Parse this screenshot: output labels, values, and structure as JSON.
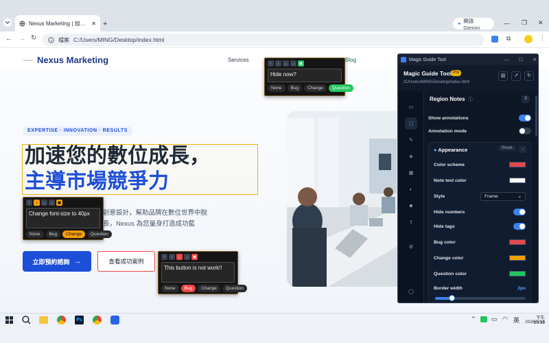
{
  "browser": {
    "tab_title": "Nexus Marketing | 加速您的數",
    "new_tab": "+",
    "gemini": "開啟 Gemini",
    "address_label": "檔案",
    "url": "C:/Users/MING/Desktop/index.html"
  },
  "site": {
    "brand": "Nexus Marketing",
    "nav": [
      "Services",
      "Blog"
    ],
    "badge": "EXPERTISE · INNOVATION · RESULTS",
    "headline_line1": "加速您的數位成長，",
    "headline_line2": "主導市場競爭力",
    "desc_line1": "創意設計，幫助品牌在數位世界中脫",
    "desc_line2": "長，Nexus 為您量身打造成功藍",
    "cta_primary": "立即預約諮詢",
    "cta_secondary": "查看成功案例"
  },
  "annotations": {
    "top": {
      "text": "Hide now?",
      "tags": [
        "None",
        "Bug",
        "Change",
        "Question"
      ],
      "selected": "Question"
    },
    "left": {
      "text": "Change font-size to 40px",
      "tags": [
        "None",
        "Bug",
        "Change",
        "Question"
      ],
      "selected": "Change"
    },
    "bottom": {
      "text": "This button is not work!!",
      "tags": [
        "None",
        "Bug",
        "Change",
        "Question"
      ],
      "selected": "Bug"
    }
  },
  "panel": {
    "window_title": "Magic Guide Tool",
    "app_name": "Magic Guide Tool",
    "pro_badge": "Pro",
    "path": "/C/Users/MING/Desktop/index.html",
    "section": "Region Notes",
    "count": "3",
    "show_annotations": "Show annotations",
    "annotation_mode": "Annotation mode",
    "appearance": "Appearance",
    "reset": "Reset",
    "color_scheme": "Color scheme",
    "note_text_color": "Note text color",
    "style": "Style",
    "style_value": "Frame",
    "hide_numbers": "Hide numbers",
    "hide_tags": "Hide tags",
    "bug_color": "Bug color",
    "change_color": "Change color",
    "question_color": "Question color",
    "border_width": "Border width",
    "border_width_value": "2px",
    "slider_fraction": 0.18,
    "colors": {
      "scheme": "#e5484d",
      "note_text": "#ffffff",
      "bug": "#e5484d",
      "change": "#f59e0b",
      "question": "#22c55e"
    }
  },
  "taskbar": {
    "ime": "英",
    "time": "下午 10:35",
    "date": "2026/6/16"
  }
}
